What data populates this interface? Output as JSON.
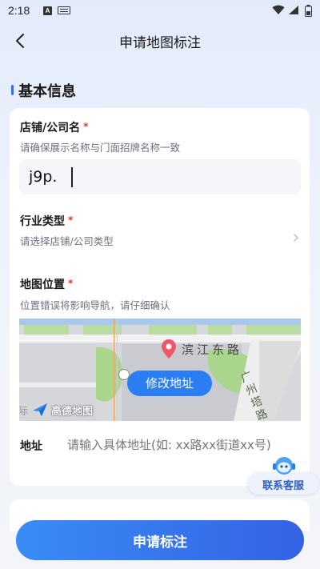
{
  "status_bar": {
    "time": "2:18",
    "a_icon": "A"
  },
  "nav": {
    "title": "申请地图标注",
    "back_icon": "chevron-left-icon"
  },
  "section": {
    "title": "基本信息"
  },
  "form": {
    "store_name": {
      "label": "店铺/公司名",
      "required_mark": "*",
      "hint": "请确保展示名称与门面招牌名称一致",
      "value": "j9p."
    },
    "industry": {
      "label": "行业类型",
      "required_mark": "*",
      "hint": "请选择店铺/公司类型"
    },
    "map_location": {
      "label": "地图位置",
      "required_mark": "*",
      "hint": "位置错误将影响导航，请仔细确认",
      "street_label": "滨江东路",
      "road_label": "广州塔路",
      "map_logo_prefix": "际",
      "map_logo": "高德地图",
      "edit_button": "修改地址"
    },
    "address": {
      "label": "地址",
      "placeholder": "请输入具体地址(如: xx路xx街道xx号)"
    }
  },
  "support": {
    "label": "联系客服"
  },
  "submit": {
    "label": "申请标注"
  },
  "colors": {
    "accent": "#3462e5",
    "required": "#e0342a",
    "map_button": "#2b7df3"
  }
}
